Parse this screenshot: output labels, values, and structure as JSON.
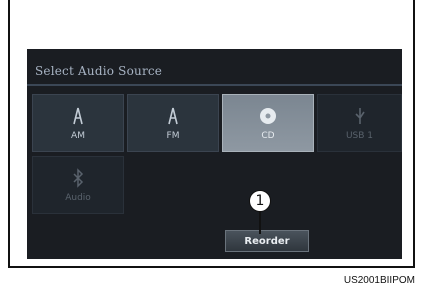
{
  "screen": {
    "title": "Select Audio Source"
  },
  "sources": [
    {
      "label": "AM",
      "icon": "antenna-icon",
      "state": "normal"
    },
    {
      "label": "FM",
      "icon": "antenna-icon",
      "state": "normal"
    },
    {
      "label": "CD",
      "icon": "disc-icon",
      "state": "selected"
    },
    {
      "label": "USB 1",
      "icon": "usb-icon",
      "state": "disabled"
    },
    {
      "label": " Audio",
      "icon": "bluetooth-icon",
      "state": "disabled"
    }
  ],
  "reorder_label": "Reorder",
  "callout_number": "1",
  "figure_code": "US2001BIIPOM",
  "colors": {
    "screen_bg": "#1a1d22",
    "tile_bg": "#2b343d",
    "tile_selected": "#8e98a2"
  }
}
